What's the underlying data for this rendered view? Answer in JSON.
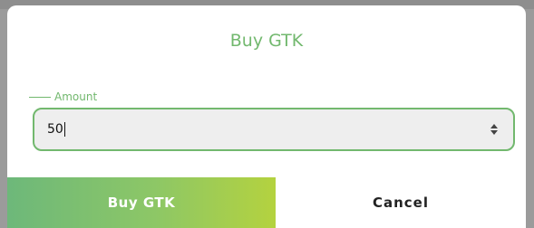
{
  "dialog": {
    "title": "Buy GTK",
    "amount_field": {
      "label": "Amount",
      "value": "50"
    },
    "buttons": {
      "buy_label": "Buy GTK",
      "cancel_label": "Cancel"
    }
  },
  "colors": {
    "accent": "#72b86e",
    "gradient_start": "#6db87a",
    "gradient_end": "#b4d23f"
  }
}
